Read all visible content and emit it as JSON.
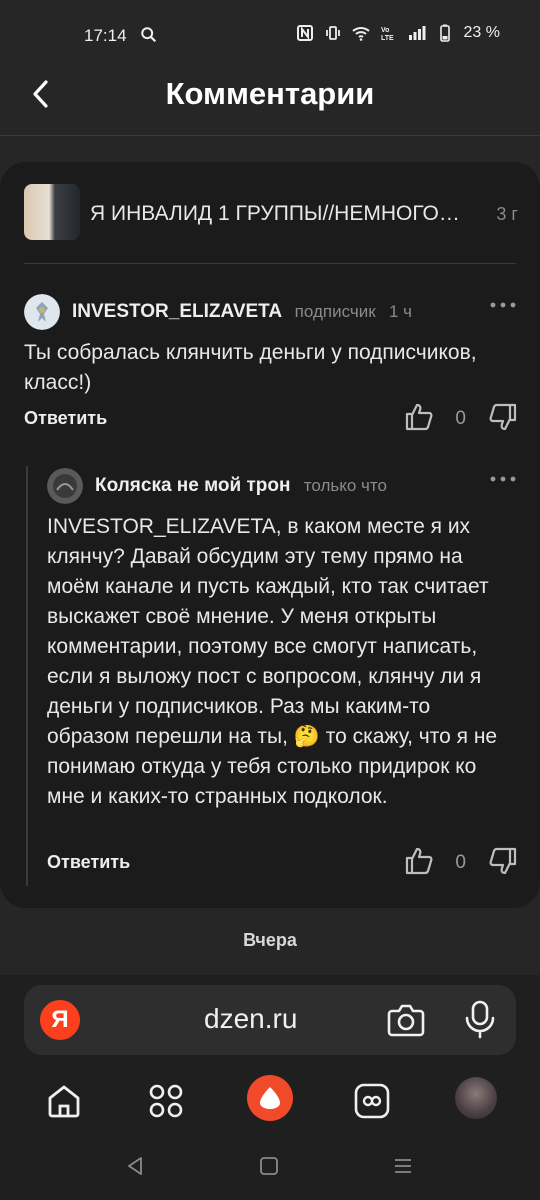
{
  "status_bar": {
    "time": "17:14",
    "battery": "23 %"
  },
  "header": {
    "title": "Комментарии"
  },
  "post": {
    "title": "Я ИНВАЛИД 1 ГРУППЫ//НЕМНОГО…",
    "age": "3 г"
  },
  "comments": [
    {
      "author": "INVESTOR_ELIZAVETA",
      "badge": "подписчик",
      "time": "1 ч",
      "text": "Ты собралась клянчить деньги у подписчиков, класс!)",
      "reply_label": "Ответить",
      "likes": "0"
    },
    {
      "author": "Коляска не мой трон",
      "time": "только что",
      "text": "INVESTOR_ELIZAVETA, в каком месте я их клянчу? Давай обсудим эту тему прямо на моём канале и пусть каждый, кто так считает выскажет своё мнение. У меня открыты комментарии, поэтому все смогут написать, если я выложу пост с вопросом, клянчу ли я деньги у подписчиков. Раз мы каким-то образом перешли на ты, 🤔 то скажу, что я не понимаю откуда у тебя столько придирок ко мне и каких-то странных подколок.",
      "reply_label": "Ответить",
      "likes": "0"
    }
  ],
  "date_separator": "Вчера",
  "browser": {
    "logo": "Я",
    "url": "dzen.ru"
  },
  "bottom_nav": {
    "items": [
      "home-icon",
      "apps-icon",
      "alice-button",
      "vpn-icon",
      "profile-avatar"
    ]
  },
  "colors": {
    "background": "#262626",
    "card": "#1b1b1b",
    "accent": "#fc3f1d"
  }
}
